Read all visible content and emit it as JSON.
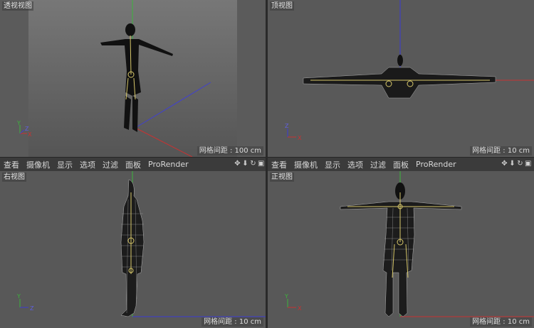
{
  "viewports": {
    "perspective": {
      "label": "透视视图",
      "grid": "网格间距 : 100 cm"
    },
    "top": {
      "label": "顶视图",
      "grid": "网格间距 : 10 cm"
    },
    "right": {
      "label": "右视图",
      "grid": "网格间距 : 10 cm"
    },
    "front": {
      "label": "正视图",
      "grid": "网格间距 : 10 cm"
    }
  },
  "menu": [
    "查看",
    "摄像机",
    "显示",
    "选项",
    "过滤",
    "面板",
    "ProRender"
  ],
  "axis_labels": {
    "x": "X",
    "y": "Y",
    "z": "Z"
  },
  "colors": {
    "x_axis": "#c83232",
    "y_axis": "#32b432",
    "z_axis": "#3c3cd2",
    "bone": "#d8c86a",
    "viewport_bg": "#5a5a5a"
  },
  "icons": [
    "move-icon",
    "arrow-down-icon",
    "rotate-icon",
    "maximize-icon"
  ]
}
